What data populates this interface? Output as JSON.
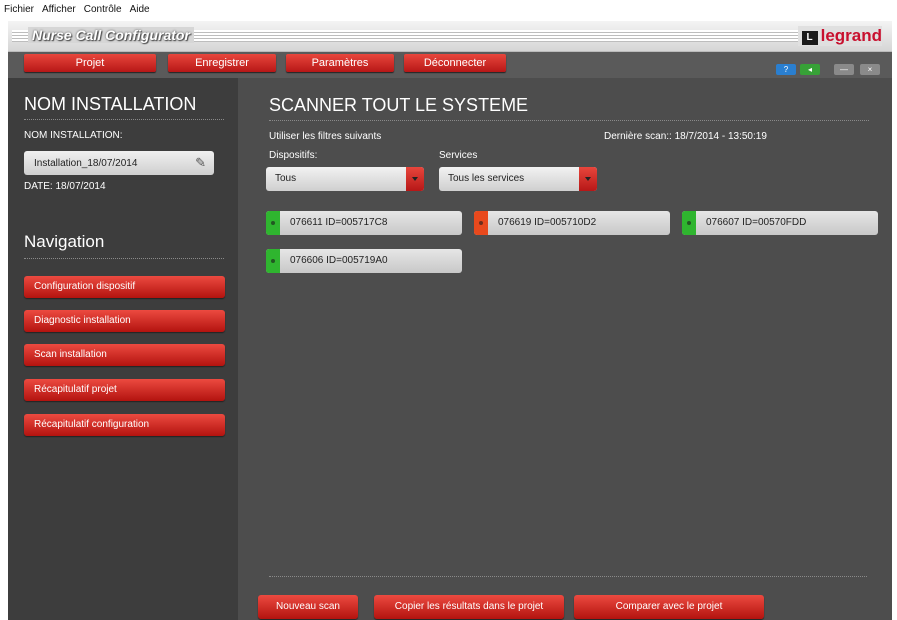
{
  "menu": [
    "Fichier",
    "Afficher",
    "Contrôle",
    "Aide"
  ],
  "app": {
    "title": "Nurse Call Configurator",
    "brand": "legrand",
    "brand_color": "#c8102e"
  },
  "toolbar": {
    "buttons": [
      "Projet",
      "Enregistrer",
      "Paramètres",
      "Déconnecter"
    ]
  },
  "window_controls": [
    "help-icon",
    "back-icon",
    "minimize-icon",
    "close-icon"
  ],
  "sidebar": {
    "install_heading": "NOM INSTALLATION",
    "install_label": "NOM INSTALLATION:",
    "install_value": "Installation_18/07/2014",
    "date": "DATE: 18/07/2014",
    "nav_heading": "Navigation",
    "nav_items": [
      "Configuration dispositif",
      "Diagnostic installation",
      "Scan installation",
      "Récapitulatif projet",
      "Récapitulatif configuration"
    ]
  },
  "main": {
    "title": "SCANNER TOUT LE SYSTEME",
    "filters_label": "Utiliser les filtres suivants",
    "last_scan": "Dernière scan:: 18/7/2014 - 13:50:19",
    "devices_label": "Dispositifs:",
    "devices_value": "Tous",
    "services_label": "Services",
    "services_value": "Tous les services",
    "devices": [
      {
        "label": "076611 ID=005717C8",
        "status_color": "#2fb52f"
      },
      {
        "label": "076619 ID=005710D2",
        "status_color": "#e8491d"
      },
      {
        "label": "076607 ID=00570FDD",
        "status_color": "#2fb52f"
      },
      {
        "label": "076606 ID=005719A0",
        "status_color": "#2fb52f"
      }
    ],
    "actions": [
      "Nouveau scan",
      "Copier les résultats dans le projet",
      "Comparer avec le projet"
    ]
  }
}
